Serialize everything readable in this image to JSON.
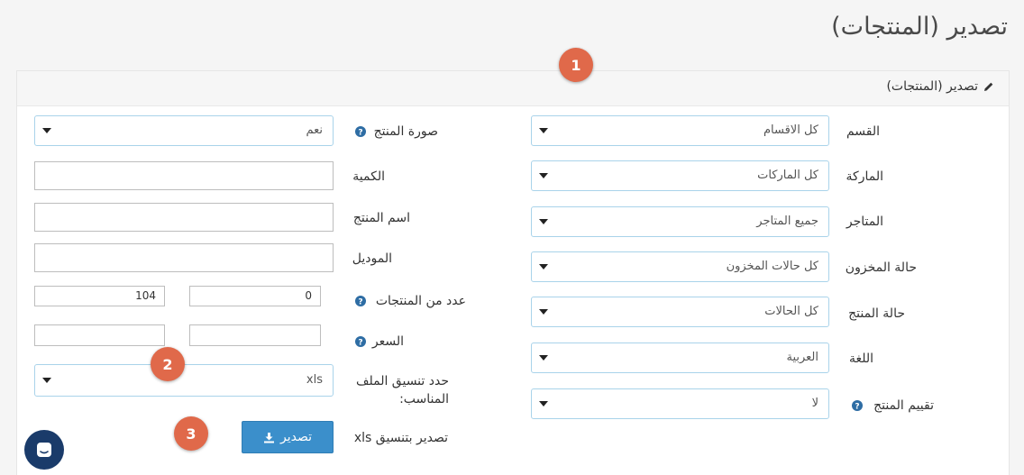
{
  "page_title": "تصدير (المنتجات)",
  "panel_title": "تصدير (المنتجات)",
  "right_col": {
    "category": {
      "label": "القسم",
      "value": "كل الاقسام"
    },
    "brand": {
      "label": "الماركة",
      "value": "كل الماركات"
    },
    "stores": {
      "label": "المتاجر",
      "value": "جميع المتاجر"
    },
    "stock_status": {
      "label": "حالة المخزون",
      "value": "كل حالات المخزون"
    },
    "product_status": {
      "label": "حالة المنتج",
      "value": "كل الحالات"
    },
    "language": {
      "label": "اللغة",
      "value": "العربية"
    },
    "rating": {
      "label": "تقييم المنتج",
      "value": "لا"
    }
  },
  "left_col": {
    "image": {
      "label": "صورة المنتج",
      "value": "نعم"
    },
    "quantity": {
      "label": "الكمية",
      "value": ""
    },
    "name": {
      "label": "اسم المنتج",
      "value": ""
    },
    "model": {
      "label": "الموديل",
      "value": ""
    },
    "count": {
      "label": "عدد من المنتجات",
      "from": "0",
      "to": "104"
    },
    "price": {
      "label": "السعر",
      "from": "",
      "to": ""
    },
    "format": {
      "label_line1": "حدد تنسيق الملف",
      "label_line2": "المناسب:",
      "value": "xls"
    },
    "export": {
      "label": "تصدير بتنسيق xls",
      "button": "تصدير"
    }
  },
  "badges": [
    "1",
    "2",
    "3"
  ],
  "icons": {
    "help": "question-circle-icon",
    "pencil": "pencil-icon",
    "download": "download-icon",
    "chat": "chat-icon"
  },
  "colors": {
    "badge": "#e0694a",
    "button": "#3b8fcb",
    "select_border": "#a9d3ea",
    "help": "#2e6da4",
    "chat": "#1a3b6a"
  }
}
